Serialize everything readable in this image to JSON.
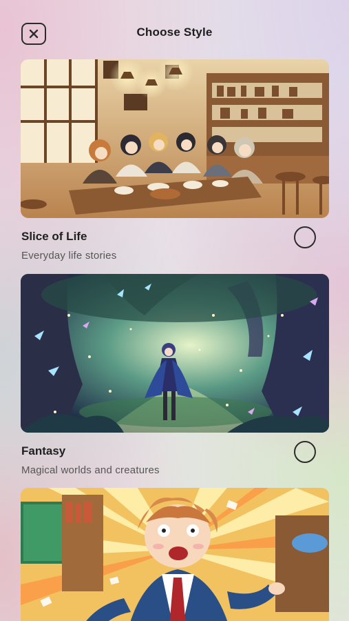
{
  "header": {
    "title": "Choose Style",
    "close_icon": "close-icon"
  },
  "styles": [
    {
      "title": "Slice of Life",
      "description": "Everyday life stories",
      "selected": false
    },
    {
      "title": "Fantasy",
      "description": "Magical worlds and creatures",
      "selected": false
    },
    {
      "title": "",
      "description": "",
      "selected": false
    }
  ],
  "colors": {
    "text_primary": "#1d1d1d",
    "text_secondary": "#555555"
  }
}
